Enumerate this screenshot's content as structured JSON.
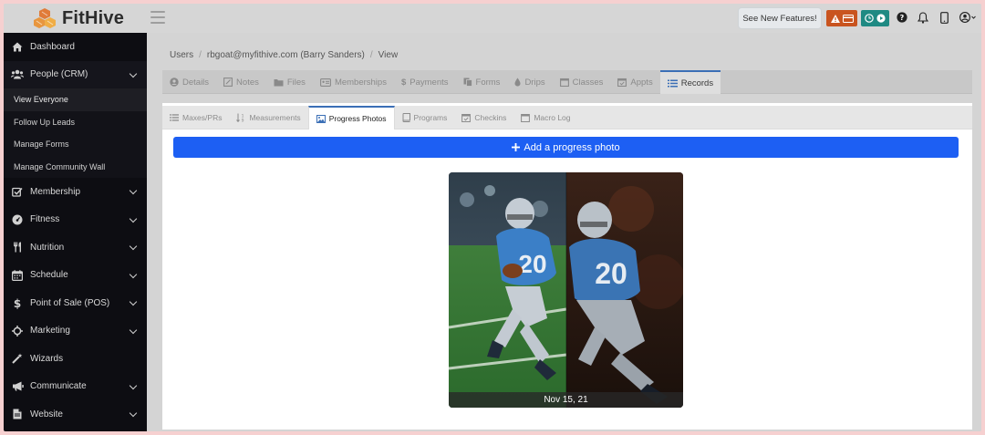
{
  "app": {
    "name": "FitHive"
  },
  "topbar": {
    "new_features_label": "See New Features!",
    "icons": [
      "menu-icon",
      "warning-icon",
      "card-icon",
      "clock-icon",
      "play-icon",
      "help-icon",
      "bell-icon",
      "mobile-icon",
      "user-icon"
    ]
  },
  "sidebar": {
    "items": [
      {
        "label": "Dashboard",
        "icon": "home-icon"
      },
      {
        "label": "People (CRM)",
        "icon": "people-icon"
      },
      {
        "label": "Membership",
        "icon": "checkbox-icon"
      },
      {
        "label": "Fitness",
        "icon": "dashboard-icon"
      },
      {
        "label": "Nutrition",
        "icon": "utensils-icon"
      },
      {
        "label": "Schedule",
        "icon": "calendar-icon"
      },
      {
        "label": "Point of Sale (POS)",
        "icon": "dollar-icon"
      },
      {
        "label": "Marketing",
        "icon": "crosshair-icon"
      },
      {
        "label": "Wizards",
        "icon": "wand-icon"
      },
      {
        "label": "Communicate",
        "icon": "bullhorn-icon"
      },
      {
        "label": "Website",
        "icon": "file-icon"
      }
    ],
    "people_sub": [
      {
        "label": "View Everyone"
      },
      {
        "label": "Follow Up Leads"
      },
      {
        "label": "Manage Forms"
      },
      {
        "label": "Manage Community Wall"
      }
    ]
  },
  "breadcrumb": [
    "Users",
    "rbgoat@myfithive.com (Barry Sanders)",
    "View"
  ],
  "record_tabs": [
    {
      "label": "Details"
    },
    {
      "label": "Notes"
    },
    {
      "label": "Files"
    },
    {
      "label": "Memberships"
    },
    {
      "label": "Payments"
    },
    {
      "label": "Forms"
    },
    {
      "label": "Drips"
    },
    {
      "label": "Classes"
    },
    {
      "label": "Appts"
    },
    {
      "label": "Records"
    }
  ],
  "records_subtabs": [
    {
      "label": "Maxes/PRs"
    },
    {
      "label": "Measurements"
    },
    {
      "label": "Progress Photos"
    },
    {
      "label": "Programs"
    },
    {
      "label": "Checkins"
    },
    {
      "label": "Macro Log"
    }
  ],
  "progress": {
    "add_label": "Add a progress photo",
    "photo_caption": "Nov 15, 21",
    "jersey_left": "20",
    "jersey_right": "20"
  },
  "colors": {
    "accent": "#1d5ff3",
    "sidebar_bg": "#0d0d12",
    "warn": "#c9541f",
    "teal": "#1f8a83"
  }
}
